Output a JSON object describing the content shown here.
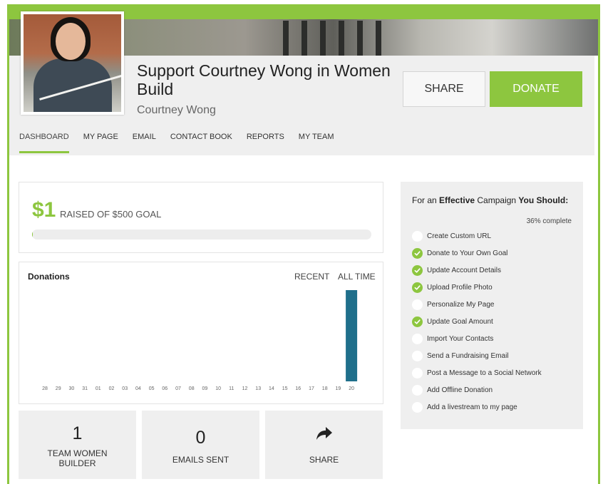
{
  "colors": {
    "accent": "#8dc63f",
    "bar": "#1f6f8b",
    "panel": "#efefef"
  },
  "header": {
    "title": "Support Courtney Wong in Women Build",
    "owner": "Courtney Wong",
    "share_label": "SHARE",
    "donate_label": "DONATE"
  },
  "nav": {
    "items": [
      "DASHBOARD",
      "MY PAGE",
      "EMAIL",
      "CONTACT BOOK",
      "REPORTS",
      "MY TEAM"
    ],
    "active": "DASHBOARD"
  },
  "fundraising": {
    "raised": "$1",
    "goal_text": "RAISED OF $500 GOAL",
    "progress_fraction": 0.002
  },
  "donations": {
    "title": "Donations",
    "tabs": [
      "RECENT",
      "ALL TIME"
    ]
  },
  "chart_data": {
    "type": "bar",
    "categories": [
      "28",
      "29",
      "30",
      "31",
      "01",
      "02",
      "03",
      "04",
      "05",
      "06",
      "07",
      "08",
      "09",
      "10",
      "11",
      "12",
      "13",
      "14",
      "15",
      "16",
      "17",
      "18",
      "19",
      "20"
    ],
    "values": [
      0,
      0,
      0,
      0,
      0,
      0,
      0,
      0,
      0,
      0,
      0,
      0,
      0,
      0,
      0,
      0,
      0,
      0,
      0,
      0,
      0,
      0,
      0,
      1
    ],
    "title": "Donations",
    "ylim": [
      0,
      1
    ],
    "grid": false
  },
  "stats": [
    {
      "number": "1",
      "label": "TEAM WOMEN BUILDER"
    },
    {
      "number": "0",
      "label": "EMAILS SENT"
    },
    {
      "icon": "share-arrow-icon",
      "label": "SHARE"
    }
  ],
  "checklist": {
    "heading_pre": "For an ",
    "heading_bold1": "Effective",
    "heading_mid": " Campaign ",
    "heading_bold2": "You Should:",
    "percent": "36% complete",
    "items": [
      {
        "label": "Create Custom URL",
        "done": false
      },
      {
        "label": "Donate to Your Own Goal",
        "done": true
      },
      {
        "label": "Update Account Details",
        "done": true
      },
      {
        "label": "Upload Profile Photo",
        "done": true
      },
      {
        "label": "Personalize My Page",
        "done": false
      },
      {
        "label": "Update Goal Amount",
        "done": true
      },
      {
        "label": "Import Your Contacts",
        "done": false
      },
      {
        "label": "Send a Fundraising Email",
        "done": false
      },
      {
        "label": "Post a Message to a Social Network",
        "done": false
      },
      {
        "label": "Add Offline Donation",
        "done": false
      },
      {
        "label": "Add a livestream to my page",
        "done": false
      }
    ]
  }
}
